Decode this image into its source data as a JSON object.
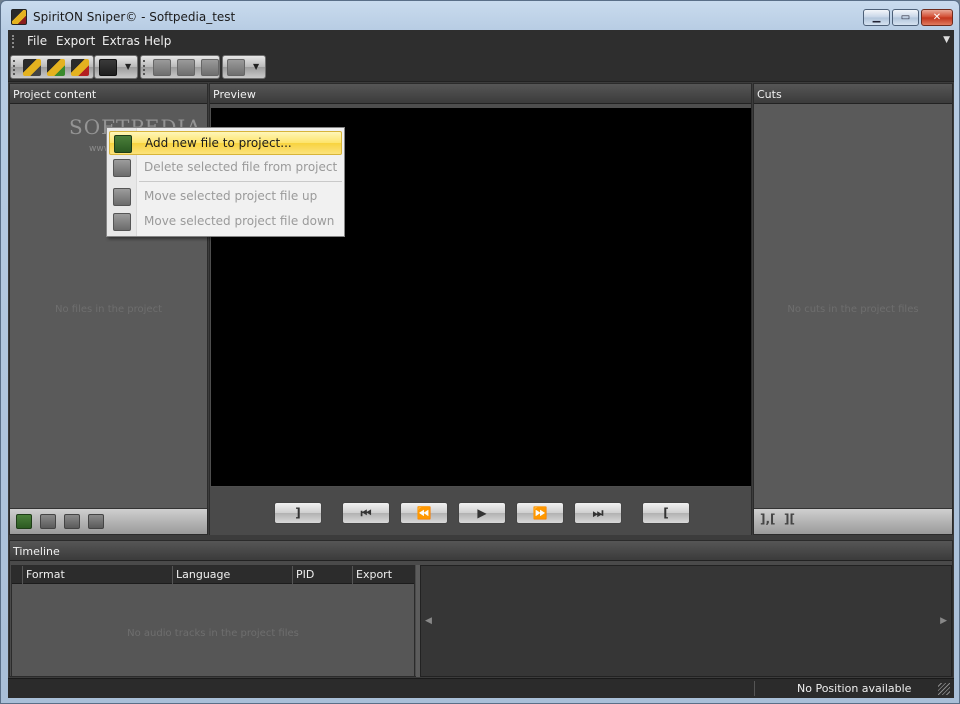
{
  "window": {
    "title": "SpiritON Sniper© - Softpedia_test"
  },
  "menu": {
    "file": "File",
    "export": "Export",
    "extras": "Extras",
    "help": "Help"
  },
  "panels": {
    "project": {
      "title": "Project content",
      "empty_text": "No files in the project"
    },
    "preview": {
      "title": "Preview"
    },
    "cuts": {
      "title": "Cuts",
      "empty_text": "No cuts in the project files"
    }
  },
  "transport": {
    "mark_out": "]",
    "go_start": "⏮",
    "rewind": "⏪",
    "play": "▶",
    "forward": "⏩",
    "go_end": "⏭",
    "mark_in": "["
  },
  "cuts_buttons": {
    "add_cut": "],[",
    "remove_cut": "]["
  },
  "timeline": {
    "title": "Timeline",
    "columns": [
      "Format",
      "Language",
      "PID",
      "Export"
    ],
    "empty_text": "No audio tracks in the project files"
  },
  "status": {
    "position": "No Position available"
  },
  "watermark": {
    "main": "SOFTPEDIA",
    "sub": "www.softpedia.com"
  },
  "context_menu": {
    "items": [
      {
        "label": "Add new file to project...",
        "enabled": true
      },
      {
        "label": "Delete selected file from project",
        "enabled": false
      },
      {
        "label": "Move selected project file up",
        "enabled": false
      },
      {
        "label": "Move selected project file down",
        "enabled": false
      }
    ]
  },
  "colors": {
    "accent_highlight": "#fde46a",
    "panel_bg": "#5a5a5a",
    "preview_bg": "#000000"
  }
}
